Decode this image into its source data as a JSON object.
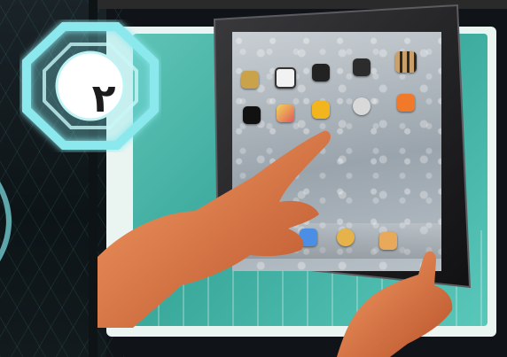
{
  "badge": {
    "number": "٢"
  },
  "colors": {
    "teal": "#3aa99c",
    "glow": "#7fe3e8",
    "tablet_frame": "#1d1d1f",
    "skin": "#e07a4a"
  },
  "icons": {
    "home_screen_apps": [
      "contacts-app-icon",
      "calendar-app-icon",
      "photos-app-icon",
      "camera-app-icon",
      "settings-grid-icon",
      "videos-app-icon",
      "maps-app-icon",
      "photo-booth-app-icon",
      "facetime-app-icon",
      "music-app-icon"
    ],
    "dock_apps": [
      "mail-app-icon",
      "safari-app-icon",
      "ibooks-app-icon"
    ]
  }
}
